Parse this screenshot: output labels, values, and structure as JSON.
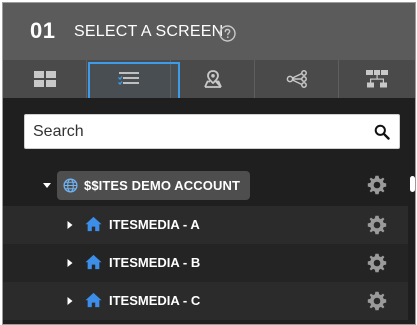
{
  "header": {
    "step": "01",
    "title": "SELECT A SCREEN",
    "help_icon": "question-circle-icon"
  },
  "tabs": [
    {
      "icon": "grid-icon",
      "active": false
    },
    {
      "icon": "list-check-icon",
      "active": true
    },
    {
      "icon": "map-pin-icon",
      "active": false
    },
    {
      "icon": "share-nodes-icon",
      "active": false
    },
    {
      "icon": "hierarchy-icon",
      "active": false
    }
  ],
  "search": {
    "placeholder": "Search",
    "value": ""
  },
  "tree": {
    "root": {
      "label": "$$ITES DEMO ACCOUNT",
      "expanded": true,
      "icon": "globe-icon"
    },
    "children": [
      {
        "label": "ITESMEDIA - A",
        "icon": "home-icon",
        "expanded": false
      },
      {
        "label": "ITESMEDIA - B",
        "icon": "home-icon",
        "expanded": false
      },
      {
        "label": "ITESMEDIA - C",
        "icon": "home-icon",
        "expanded": false
      }
    ]
  },
  "colors": {
    "accent": "#3d9be9",
    "header_bg": "#5b5b5b",
    "tabs_bg": "#4a4a4a",
    "panel_bg": "#1f1f1f",
    "home_icon": "#3d8ee8",
    "gear": "#9a9a9a"
  }
}
